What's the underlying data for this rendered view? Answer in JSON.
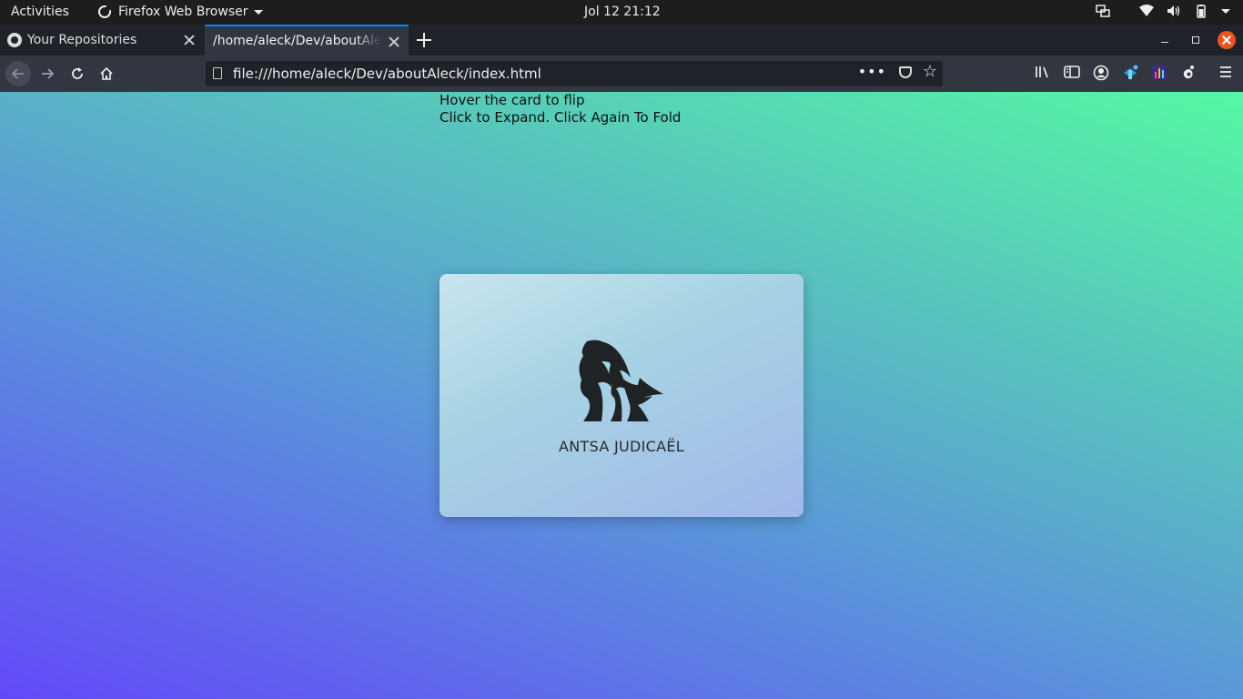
{
  "topbar": {
    "activities": "Activities",
    "app_name": "Firefox Web Browser",
    "clock": "Jol 12  21:12"
  },
  "tabs": [
    {
      "title": "Your Repositories",
      "icon": "github-icon"
    },
    {
      "title": "/home/aleck/Dev/aboutAleck",
      "icon": ""
    }
  ],
  "navbar": {
    "url": "file:///home/aleck/Dev/aboutAleck/index.html",
    "more": "•••"
  },
  "page": {
    "hint_line1": "Hover the card to flip",
    "hint_line2": "Click to Expand. Click Again To Fold",
    "card_name": "ANTSA JUDICAËL"
  },
  "colors": {
    "accent": "#0a84ff",
    "close_button": "#e95420",
    "gradient_start": "#6349f8",
    "gradient_end": "#55f8a3"
  }
}
